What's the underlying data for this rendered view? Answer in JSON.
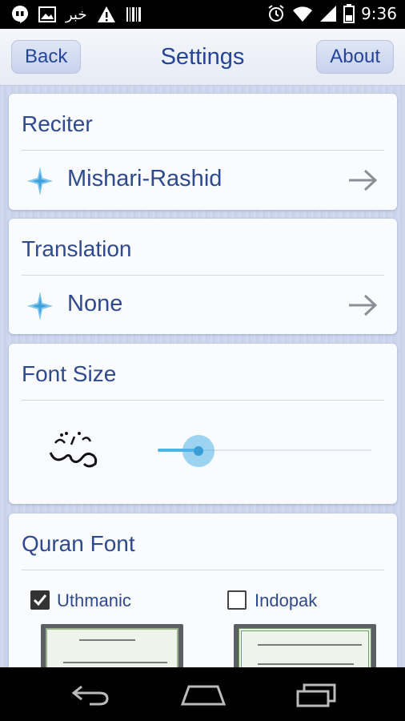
{
  "status_bar": {
    "arabic_notification": "خبر",
    "time": "9:36"
  },
  "header": {
    "back_label": "Back",
    "title": "Settings",
    "about_label": "About"
  },
  "reciter": {
    "title": "Reciter",
    "value": "Mishari-Rashid",
    "icon": "audio-wave-icon"
  },
  "translation": {
    "title": "Translation",
    "value": "None",
    "icon": "audio-wave-icon"
  },
  "font_size": {
    "title": "Font Size",
    "slider_fraction": 0.19,
    "sample_icon": "arabic-surah-glyph"
  },
  "quran_font": {
    "title": "Quran Font",
    "options": [
      {
        "label": "Uthmanic",
        "checked": true
      },
      {
        "label": "Indopak",
        "checked": false
      }
    ]
  },
  "colors": {
    "accent": "#24449a",
    "text": "#2e4a8e",
    "slider": "#4fb3e6"
  }
}
